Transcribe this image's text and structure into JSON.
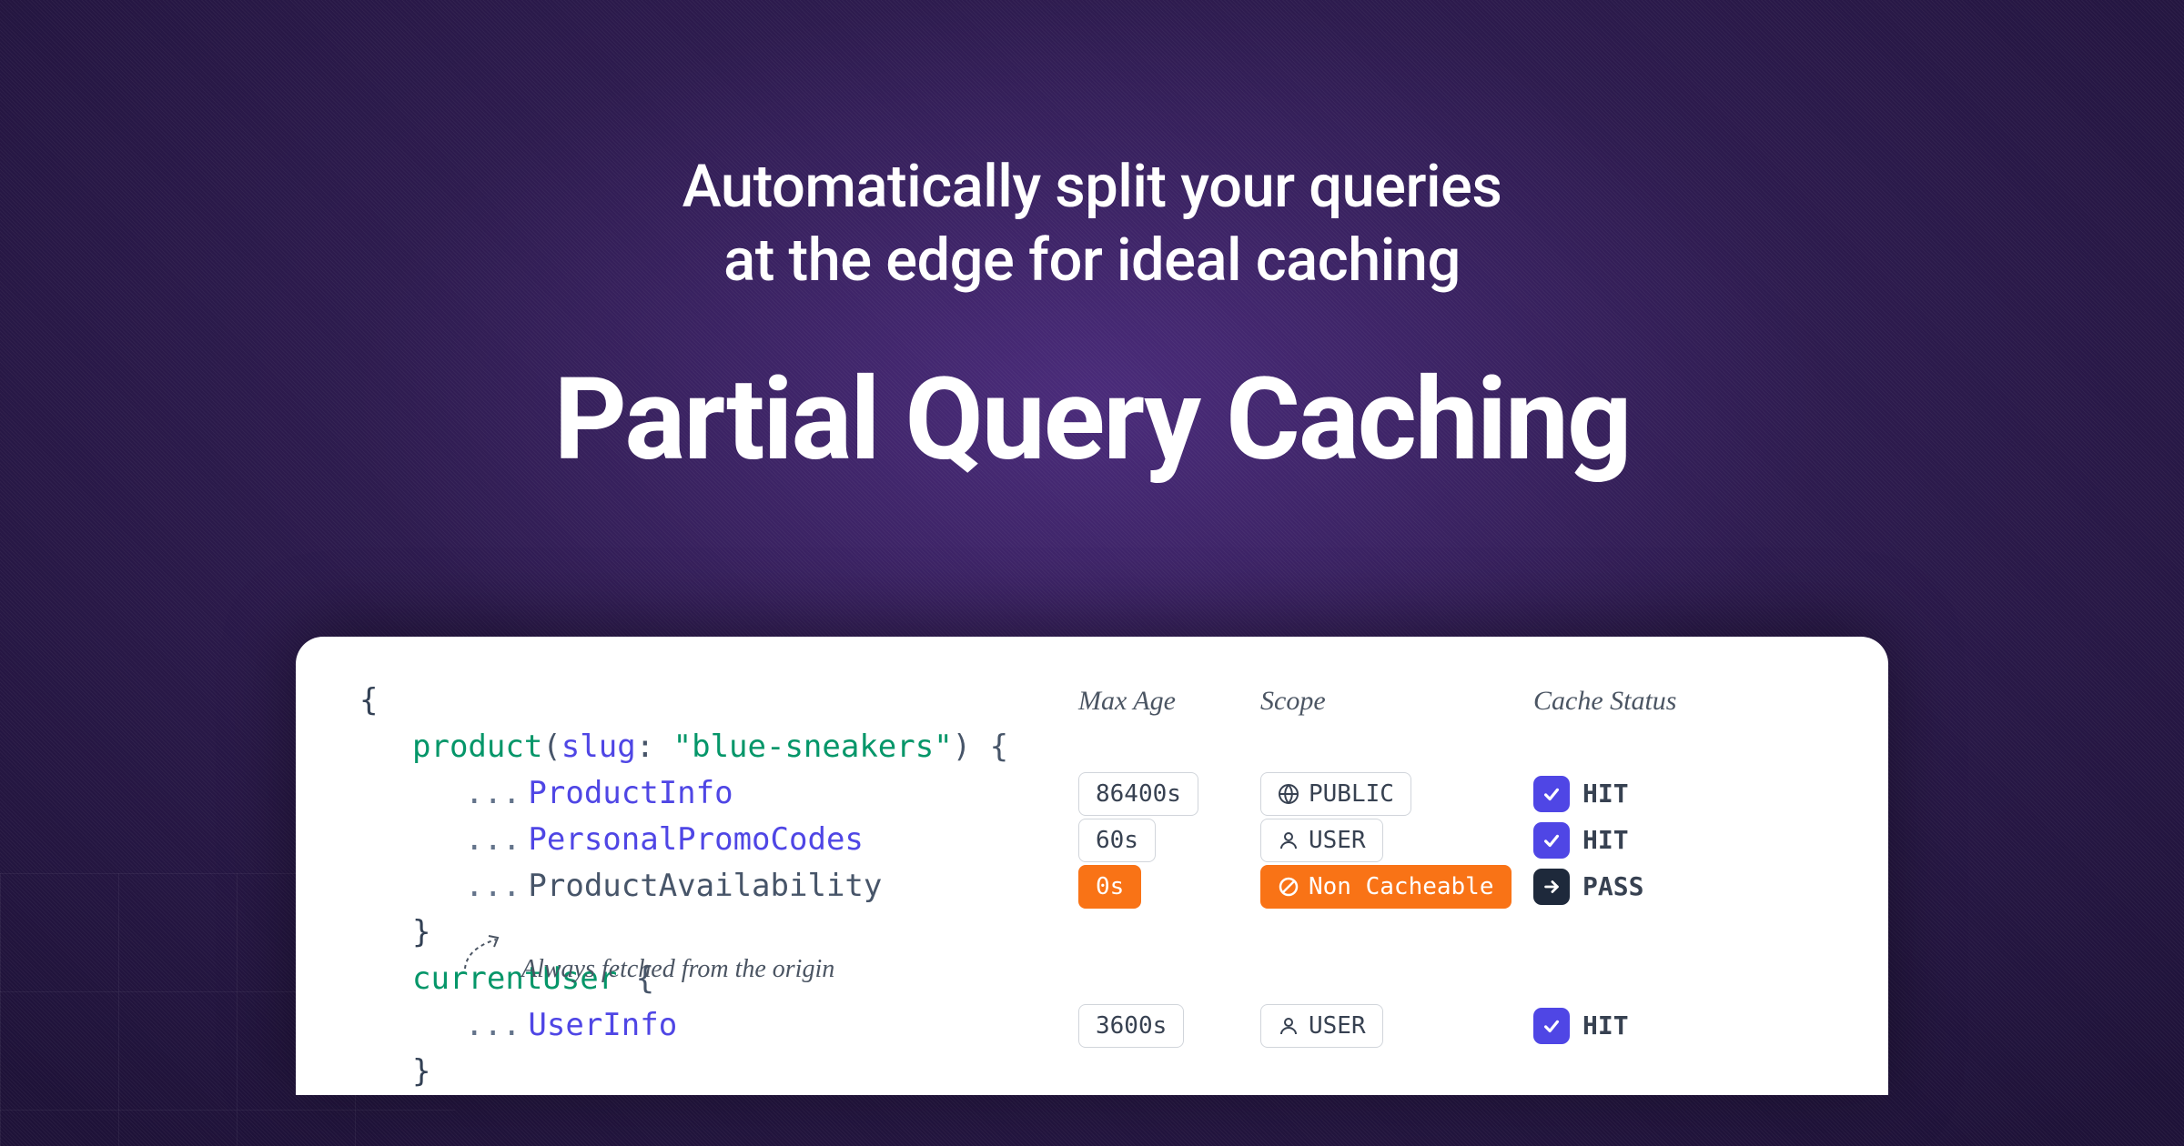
{
  "hero": {
    "subtitle_l1": "Automatically split your queries",
    "subtitle_l2": "at the edge for ideal caching",
    "title": "Partial Query Caching"
  },
  "headers": {
    "maxage": "Max Age",
    "scope": "Scope",
    "cache": "Cache Status"
  },
  "code": {
    "open": "{",
    "product_start": "product",
    "product_args_open": "(",
    "arg_key": "slug",
    "arg_colon": ": ",
    "arg_val": "\"blue-sneakers\"",
    "product_args_close": ") {",
    "frag1": "ProductInfo",
    "frag2": "PersonalPromoCodes",
    "frag3": "ProductAvailability",
    "close_product": "}",
    "current_user": "currentUser",
    "cu_open": " {",
    "frag4": "UserInfo",
    "close_cu": "}"
  },
  "rows": {
    "r1": {
      "maxage": "86400s",
      "scope": "PUBLIC",
      "status": "HIT"
    },
    "r2": {
      "maxage": "60s",
      "scope": "USER",
      "status": "HIT"
    },
    "r3": {
      "maxage": "0s",
      "scope": "Non Cacheable",
      "status": "PASS"
    },
    "r4": {
      "maxage": "3600s",
      "scope": "USER",
      "status": "HIT"
    }
  },
  "annotation": "Always fetched from the origin",
  "dots": "..."
}
